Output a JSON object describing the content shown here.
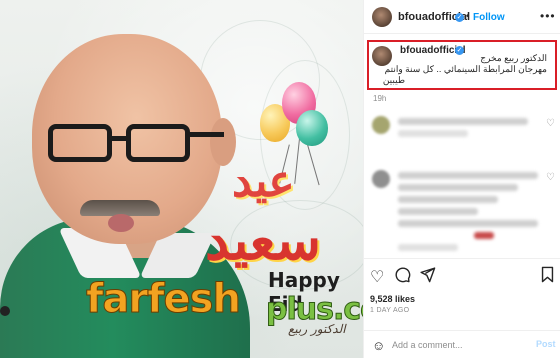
{
  "image": {
    "greeting_ar_line1": "عيد",
    "greeting_ar_line2": "سعيد",
    "greeting_en": "Happy Eid",
    "signature": "الدكتور ربيع",
    "watermark_part1": "farfesh",
    "watermark_part2": "plus.com",
    "balloon_colors": [
      "#f06ba0",
      "#f7c95a",
      "#43bfa2"
    ]
  },
  "header": {
    "username": "bfouadofficial",
    "separator": "•",
    "follow_label": "Follow",
    "more_label": "•••"
  },
  "caption": {
    "username": "bfouadofficial",
    "line1": "الدكتور ربيع مخرج",
    "line2": "مهرجان المرابطة السينمائي .. كل سنة وانتم",
    "line3": "طيبين",
    "time": "19h",
    "highlight_color": "#d91e27"
  },
  "actions": {
    "likes": "9,528 likes",
    "date": "1 DAY AGO"
  },
  "comment_box": {
    "placeholder": "Add a comment...",
    "post_label": "Post"
  },
  "icons": [
    "verified-icon",
    "more-icon",
    "heart-icon",
    "comment-icon",
    "share-icon",
    "bookmark-icon",
    "emoji-icon"
  ]
}
